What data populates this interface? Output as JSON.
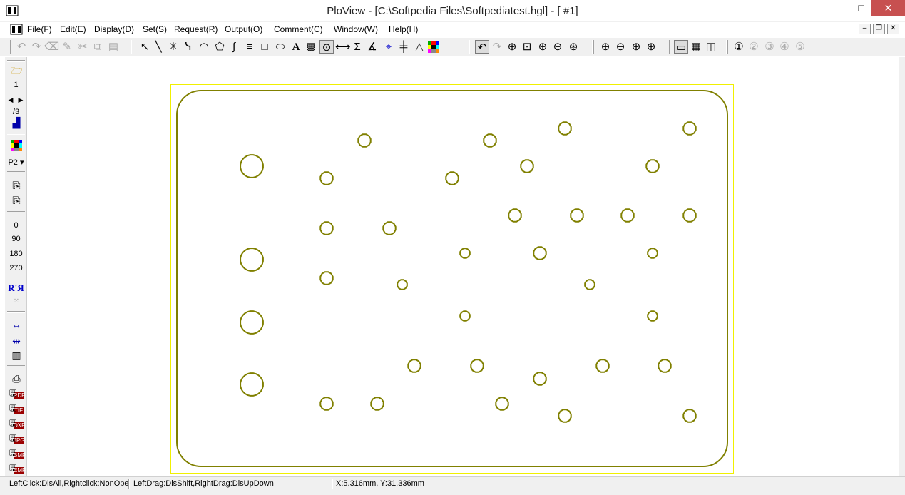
{
  "window": {
    "title": "PloView - [C:\\Softpedia Files\\Softpediatest.hgl] - [ #1]",
    "minimize": "—",
    "maximize": "□",
    "close": "✕"
  },
  "menu": {
    "items": [
      "File(F)",
      "Edit(E)",
      "Display(D)",
      "Set(S)",
      "Request(R)",
      "Output(O)",
      "Comment(C)",
      "Window(W)",
      "Help(H)"
    ],
    "mdi_minimize": "–",
    "mdi_restore": "❐",
    "mdi_close": "✕"
  },
  "left_toolbar": {
    "page_number": "1",
    "page_total": "/3",
    "pen_select": "P2 ▾",
    "rotations": [
      "0",
      "90",
      "180",
      "270"
    ],
    "mirror_label": "R'Я",
    "export_formats": [
      "PDF",
      "TIF",
      "DXF",
      "JPG",
      "BMP",
      "EMF"
    ]
  },
  "toolbar": {
    "icons": [
      "undo-icon",
      "redo-icon",
      "eraser-icon",
      "pen-icon",
      "cut-icon",
      "copy-icon",
      "paste-icon",
      "select-arrow-icon",
      "line-icon",
      "cross-line-icon",
      "polyline-icon",
      "arc-icon",
      "polygon-icon",
      "curve-icon",
      "multiline-icon",
      "rectangle-icon",
      "ellipse-icon",
      "text-icon",
      "hatch-icon",
      "circle-icon",
      "dimension-icon",
      "sigma-icon",
      "angle-icon",
      "crosshair-icon",
      "grid-line-icon",
      "triangle-icon",
      "color-palette-icon",
      "zoom-undo-icon",
      "zoom-redo-icon",
      "zoom-area-icon",
      "zoom-window-icon",
      "zoom-in-icon",
      "zoom-out-icon",
      "zoom-fit-icon",
      "zoom-in-left-icon",
      "zoom-out-left-icon",
      "zoom-up-icon",
      "zoom-down-icon",
      "single-view-icon",
      "table-view-icon",
      "split-view-icon",
      "info-1-icon",
      "info-2-icon",
      "info-3-icon",
      "info-4-icon",
      "info-5-icon"
    ]
  },
  "drawing": {
    "stroke_color": "#808000",
    "frame_color": "#f0f000"
  },
  "status": {
    "mouse_hint": "LeftClick:DisAll,Rightclick:NonOpe",
    "drag_hint": "LeftDrag:DisShift,RightDrag:DisUpDown",
    "coords": "X:5.316mm, Y:31.336mm"
  }
}
